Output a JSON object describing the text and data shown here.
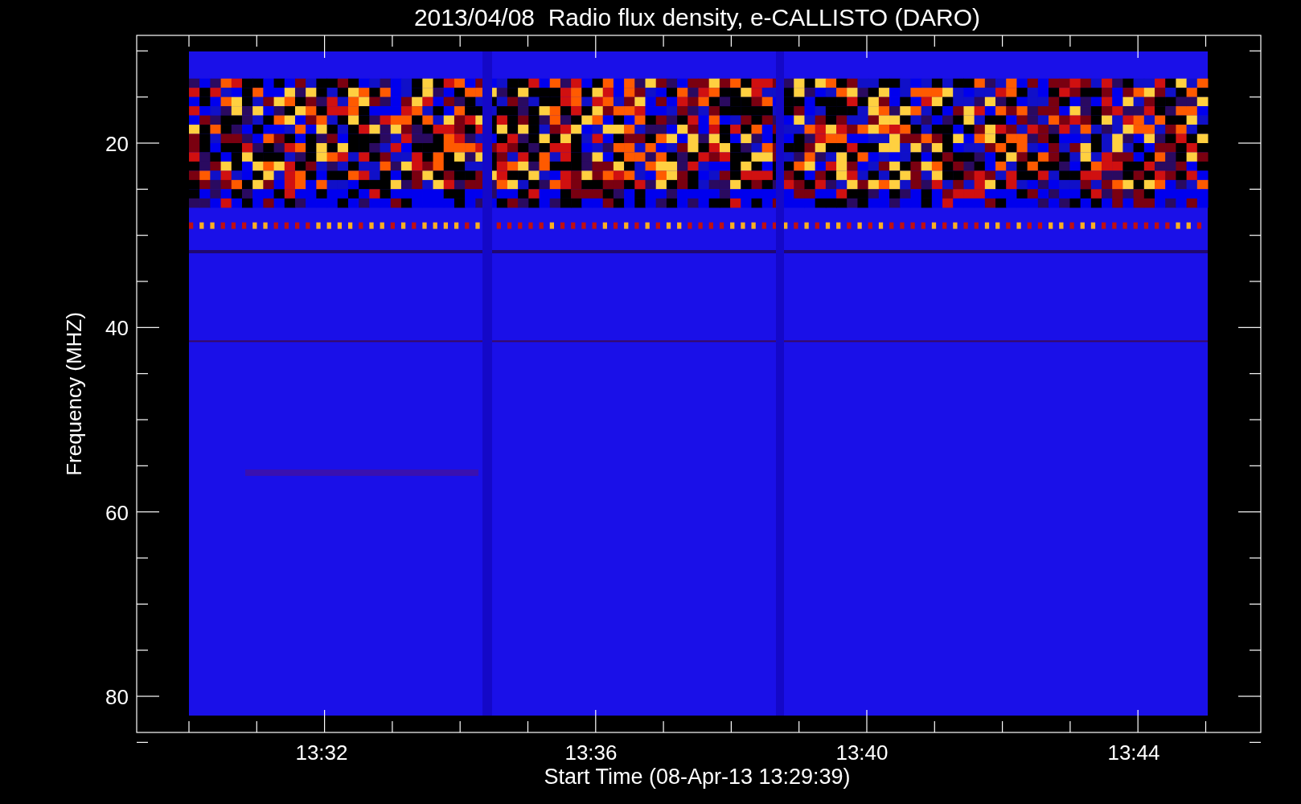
{
  "title": "2013/04/08  Radio flux density, e-CALLISTO (DARO)",
  "ylabel": "Frequency (MHZ)",
  "xlabel": "Start Time (08-Apr-13 13:29:39)",
  "yticks": [
    "20",
    "40",
    "60",
    "80"
  ],
  "xticks": [
    "13:32",
    "13:36",
    "13:40",
    "13:44"
  ]
}
